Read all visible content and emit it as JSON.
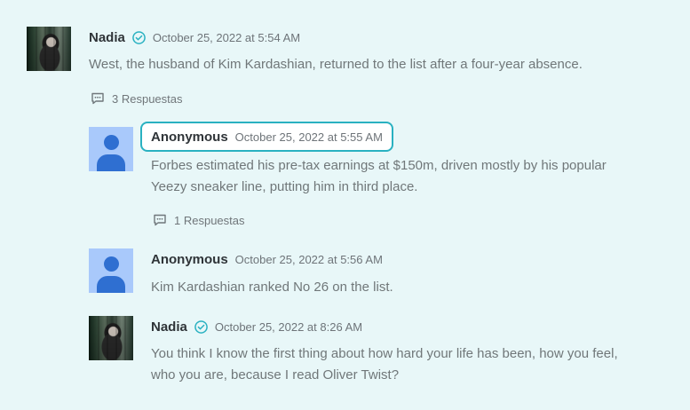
{
  "comments": [
    {
      "author": "Nadia",
      "verified": true,
      "date": "October 25, 2022 at 5:54 AM",
      "text": "West, the husband of Kim Kardashian, returned to the list after a four-year absence.",
      "replies_label": "3 Respuestas"
    },
    {
      "author": "Anonymous",
      "verified": false,
      "date": "October 25, 2022 at 5:55 AM",
      "text_line1": "Forbes estimated his pre-tax earnings at $150m, driven mostly by his popular",
      "text_line2": "Yeezy sneaker line, putting him in third place.",
      "replies_label": "1 Respuestas"
    },
    {
      "author": "Anonymous",
      "verified": false,
      "date": "October 25, 2022 at 5:56 AM",
      "text": "Kim Kardashian ranked No 26 on the list."
    },
    {
      "author": "Nadia",
      "verified": true,
      "date": "October 25, 2022 at 8:26 AM",
      "text_line1": "You think I know the first thing about how hard your life has been, how you feel,",
      "text_line2": "who you are, because I read Oliver Twist?"
    }
  ],
  "icons": {
    "verified": "check-circle-icon",
    "replies": "comment-bubble-icon",
    "avatar_default": "person-icon"
  },
  "colors": {
    "background": "#e8f7f8",
    "accent": "#29b1c1",
    "avatar_default": "#a9c9fb",
    "avatar_person": "#2f6fd1"
  }
}
